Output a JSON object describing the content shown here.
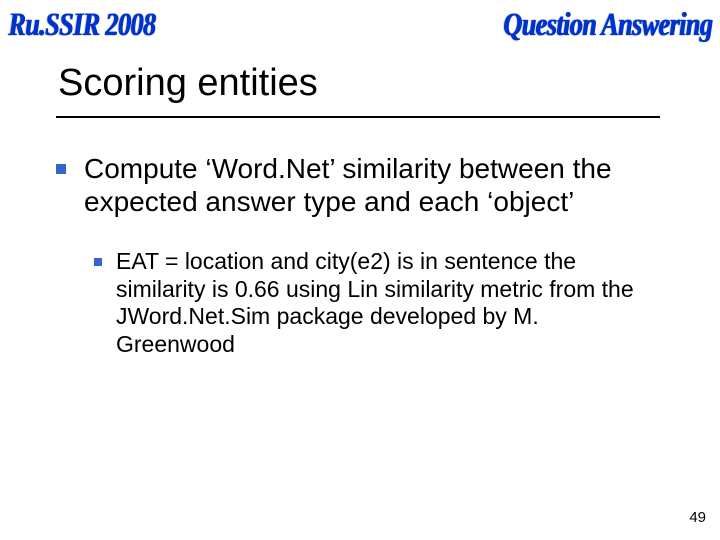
{
  "header": {
    "left": "Ru.SSIR 2008",
    "right": "Question Answering"
  },
  "title": "Scoring entities",
  "bullets": {
    "lvl1": "Compute ‘Word.Net’ similarity between the expected answer type and each ‘object’",
    "lvl2": "EAT = location and city(e2) is in sentence the similarity is 0.66 using Lin similarity metric from the JWord.Net.Sim package developed by M. Greenwood"
  },
  "page_number": "49"
}
